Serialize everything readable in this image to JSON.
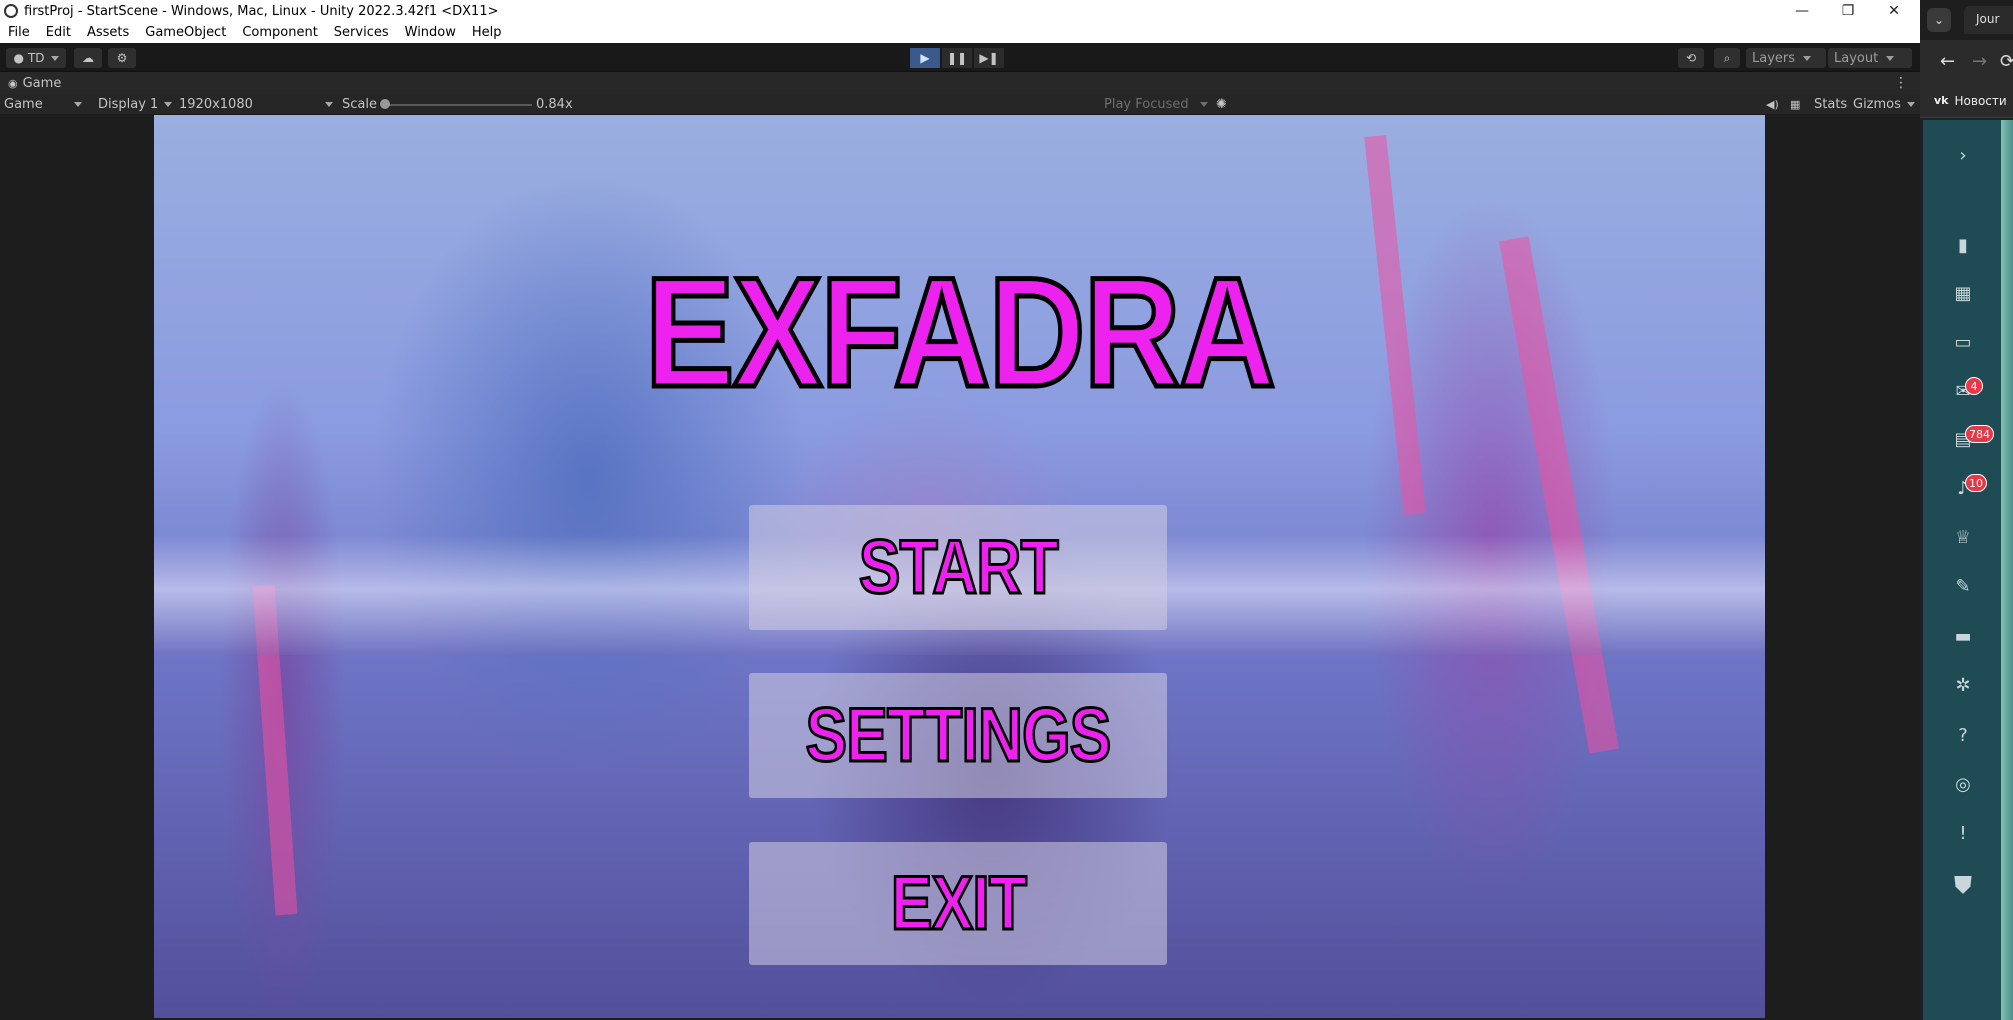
{
  "window": {
    "title": "firstProj - StartScene - Windows, Mac, Linux - Unity 2022.3.42f1 <DX11>",
    "minimize": "—",
    "restore": "❐",
    "close": "✕"
  },
  "menu": [
    "File",
    "Edit",
    "Assets",
    "GameObject",
    "Component",
    "Services",
    "Window",
    "Help"
  ],
  "toolbar": {
    "account": "TD",
    "layers": "Layers",
    "layout": "Layout"
  },
  "tab": {
    "label": "Game"
  },
  "gamebar": {
    "mode": "Game",
    "display": "Display 1",
    "resolution": "1920x1080",
    "scale_label": "Scale",
    "scale_value": "0.84x",
    "play_focused": "Play Focused",
    "stats": "Stats",
    "gizmos": "Gizmos"
  },
  "game": {
    "title": "EXFADRA",
    "buttons": {
      "start": "START",
      "settings": "SETTINGS",
      "exit": "EXIT"
    },
    "accent_color": "#ee22ee"
  },
  "browser": {
    "tab_label": "Jour",
    "bookmark": "Новости",
    "badges": {
      "messages": "4",
      "apps": "784",
      "notifications": "10"
    }
  }
}
